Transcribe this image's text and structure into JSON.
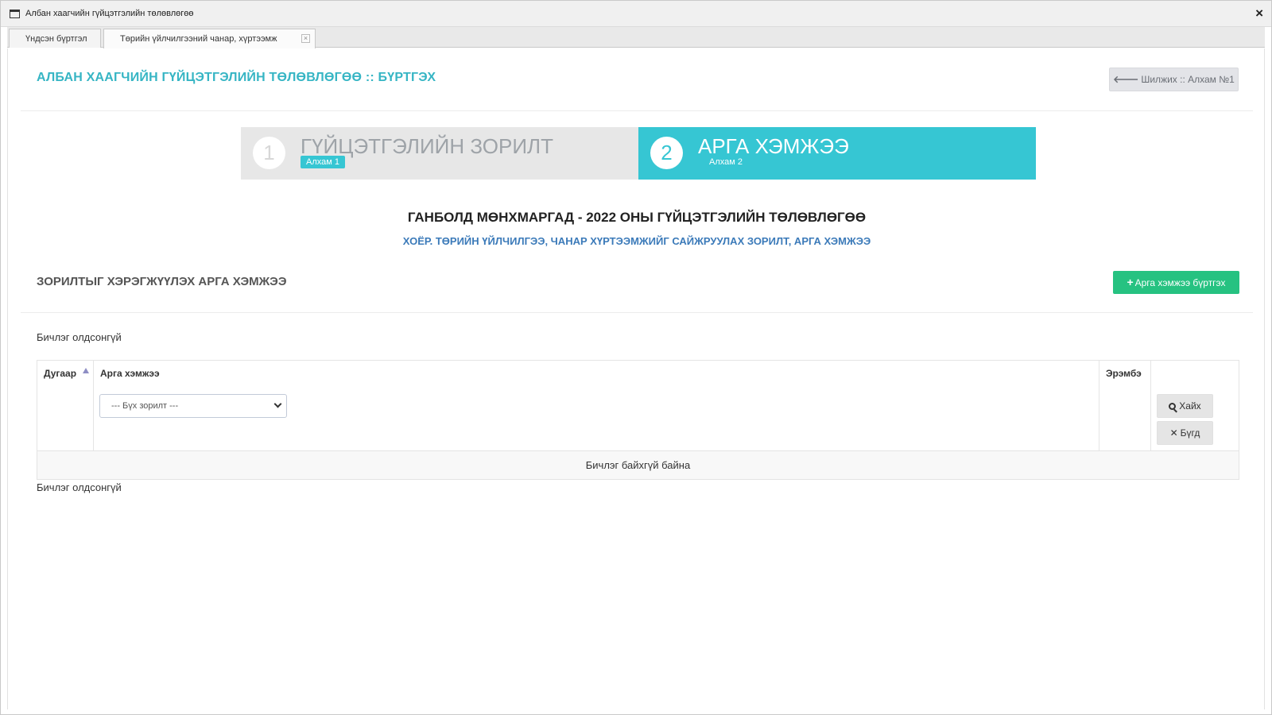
{
  "window": {
    "title": "Албан хаагчийн гүйцэтгэлийн төлөвлөгөө",
    "close_label": "×"
  },
  "tabs": [
    {
      "label": "Үндсэн бүртгэл"
    },
    {
      "label": "Төрийн үйлчилгээний чанар, хүртээмж"
    }
  ],
  "page": {
    "title": "АЛБАН ХААГЧИЙН ГҮЙЦЭТГЭЛИЙН ТӨЛӨВЛӨГӨӨ :: БҮРТГЭХ",
    "back_label": "Шилжих :: Алхам №1"
  },
  "wizard": {
    "steps": [
      {
        "number": "1",
        "title": "ГҮЙЦЭТГЭЛИЙН ЗОРИЛТ",
        "sub": "Алхам 1",
        "active": false
      },
      {
        "number": "2",
        "title": "АРГА ХЭМЖЭЭ",
        "sub": "Алхам 2",
        "active": true
      }
    ]
  },
  "plan": {
    "title": "ГАНБОЛД МӨНХМАРГАД - 2022 ОНЫ ГҮЙЦЭТГЭЛИЙН ТӨЛӨВЛӨГӨӨ",
    "subtitle": "ХОЁР. ТӨРИЙН ҮЙЛЧИЛГЭЭ, ЧАНАР ХҮРТЭЭМЖИЙГ САЙЖРУУЛАХ ЗОРИЛТ, АРГА ХЭМЖЭЭ"
  },
  "section": {
    "title": "ЗОРИЛТЫГ ХЭРЭГЖҮҮЛЭХ АРГА ХЭМЖЭЭ",
    "add_label": "Арга хэмжээ бүртгэх"
  },
  "table": {
    "no_record_text": "Бичлэг олдсонгүй",
    "columns": [
      "Дугаар",
      "Арга хэмжээ",
      "Эрэмбэ"
    ],
    "filter_select_value": "--- Бүх зорилт ---",
    "search_label": "Хайх",
    "clear_label": "Бүгд",
    "empty_message": "Бичлэг байхгүй байна"
  },
  "colors": {
    "accent": "#36c6d3",
    "title": "#36b5c4",
    "subtitle": "#3b7ab9",
    "success": "#26c281"
  }
}
